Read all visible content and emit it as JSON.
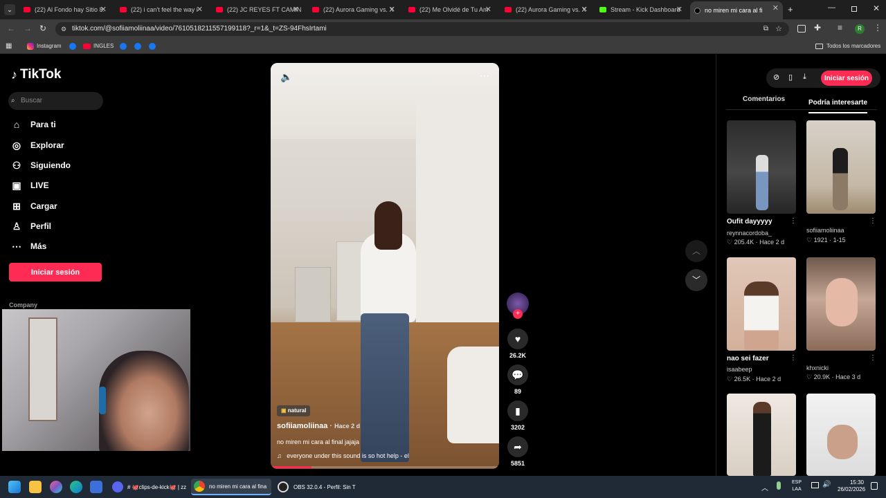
{
  "tabs": [
    {
      "label": "(22) Al Fondo hay Sitio 8:"
    },
    {
      "label": "(22) i can't feel the way i"
    },
    {
      "label": "(22) JC REYES FT CAMIN"
    },
    {
      "label": "(22) Aurora Gaming vs. X"
    },
    {
      "label": "(22) Me Olvidé de Tu Am"
    },
    {
      "label": "(22) Aurora Gaming vs. X"
    },
    {
      "label": "Stream - Kick Dashboard"
    },
    {
      "label": "no miren mi cara al fi"
    }
  ],
  "address": {
    "url": "tiktok.com/@sofiiamoliinaa/video/7610518211557199118?_r=1&_t=ZS-94FhsIrtami"
  },
  "bookmarks": {
    "instagram": "Instagram",
    "ingles": "INGLES",
    "all": "Todos los marcadores"
  },
  "brand": {
    "logo": "TikTok"
  },
  "search": {
    "placeholder": "Buscar"
  },
  "nav": [
    {
      "label": "Para ti",
      "icon": "home-icon"
    },
    {
      "label": "Explorar",
      "icon": "compass-icon"
    },
    {
      "label": "Siguiendo",
      "icon": "following-icon"
    },
    {
      "label": "LIVE",
      "icon": "live-icon"
    },
    {
      "label": "Cargar",
      "icon": "upload-icon"
    },
    {
      "label": "Perfil",
      "icon": "profile-icon"
    },
    {
      "label": "Más",
      "icon": "more-icon"
    }
  ],
  "login_label": "Iniciar sesión",
  "company_label": "Company",
  "video": {
    "badge": "natural",
    "author": "sofiiamoliinaa",
    "age": "Hace 2 d",
    "caption": "no miren mi cara al final jajaja",
    "sound": "everyone under this sound is so hot help - el",
    "progress": 0.18
  },
  "actions": {
    "likes": "26.2K",
    "comments": "89",
    "saves": "3202",
    "shares": "5851"
  },
  "right_panel": {
    "tab_comments": "Comentarios",
    "tab_interest": "Podría interesarte",
    "login": "Iniciar sesión"
  },
  "recommendations": [
    {
      "title": "Oufit dayyyyy",
      "author": "reynnacordoba_",
      "likes": "205.4K",
      "date": "Hace 2 d"
    },
    {
      "title": "",
      "author": "sofiiamoliinaa",
      "likes": "1921",
      "date": "1-15"
    },
    {
      "title": "nao sei fazer",
      "author": "isaabeep",
      "likes": "26.5K",
      "date": "Hace 2 d"
    },
    {
      "title": "",
      "author": "khxnicki",
      "likes": "20.9K",
      "date": "Hace 3 d"
    }
  ],
  "taskbar": {
    "discord": "# 🐙clips-de-kick🐙 | zz",
    "chrome": "no miren mi cara al fina",
    "obs": "OBS 32.0.4 - Perfil: Sin T",
    "lang1": "ESP",
    "lang2": "LAA",
    "time": "15:30",
    "date": "26/02/2026"
  },
  "colors": {
    "accent": "#fe2c55",
    "kick": "#53fc18",
    "youtube": "#ff0033"
  }
}
